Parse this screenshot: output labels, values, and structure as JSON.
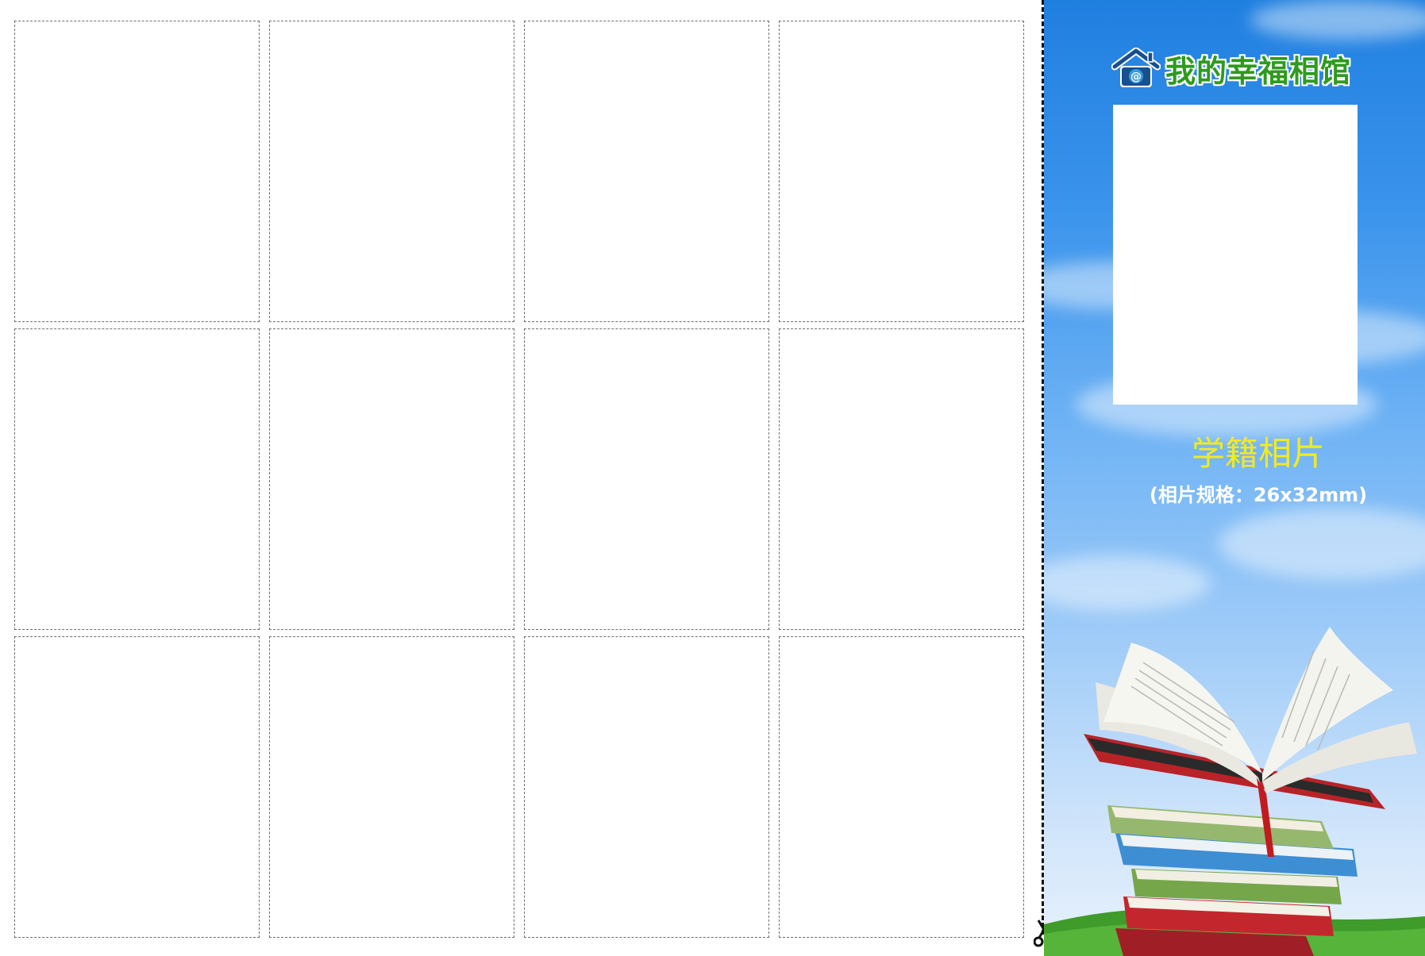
{
  "photo_grid": {
    "columns": 4,
    "rows": 3,
    "cell_count": 12
  },
  "panel": {
    "brand_name": "我的幸福相馆",
    "title": "学籍相片",
    "spec": "(相片规格：26x32mm)"
  },
  "icons": {
    "brand_logo": "house-at-icon",
    "cut_marker": "scissors-icon",
    "illustration": "open-book-stack"
  },
  "colors": {
    "sky_top": "#1f7fe0",
    "sky_bottom": "#e8f2fc",
    "brand_green": "#2f9a1e",
    "title_yellow": "#f3ea1f",
    "logo_blue": "#1a4f8f",
    "cell_border": "#6e6e6e"
  }
}
